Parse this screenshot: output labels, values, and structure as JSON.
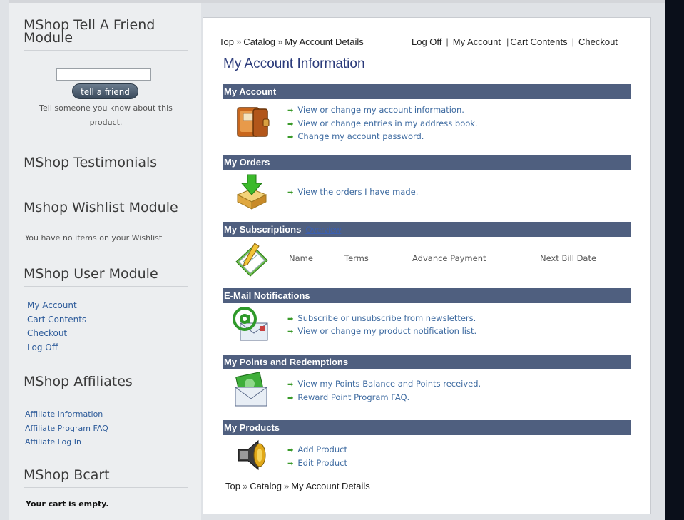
{
  "sidebar": {
    "tell_friend": {
      "title": "MShop Tell A Friend Module",
      "input_value": "",
      "button_label": "tell a friend",
      "description_line1": "Tell someone you know about this",
      "description_line2": "product."
    },
    "testimonials": {
      "title": "MShop Testimonials"
    },
    "wishlist": {
      "title": "Mshop Wishlist Module",
      "empty_text": "You have no items on your Wishlist"
    },
    "user_module": {
      "title": "MShop User Module",
      "links": [
        "My Account",
        "Cart Contents",
        "Checkout",
        "Log Off"
      ]
    },
    "affiliates": {
      "title": "MShop Affiliates",
      "links": [
        "Affiliate Information",
        "Affiliate Program FAQ",
        "Affiliate Log In"
      ]
    },
    "bcart": {
      "title": "MShop Bcart",
      "empty_text": "Your cart is empty."
    }
  },
  "breadcrumb": {
    "top": "Top",
    "sep": "»",
    "catalog": "Catalog",
    "current": "My Account Details"
  },
  "topnav": {
    "log_off": "Log Off",
    "my_account": "My Account",
    "cart_contents": "Cart Contents",
    "checkout": "Checkout",
    "sep": "|"
  },
  "page_title": "My Account Information",
  "sections": {
    "my_account": {
      "title": "My Account",
      "links": [
        "View or change my account information.",
        "View or change entries in my address book.",
        "Change my account password."
      ]
    },
    "my_orders": {
      "title": "My Orders",
      "links": [
        "View the orders I have made."
      ]
    },
    "my_subscriptions": {
      "title": "My Subscriptions",
      "overview_label": "Overview",
      "columns": [
        "Name",
        "Terms",
        "Advance Payment",
        "Next Bill Date"
      ]
    },
    "email_notifications": {
      "title": "E-Mail Notifications",
      "links": [
        "Subscribe or unsubscribe from newsletters.",
        "View or change my product notification list."
      ]
    },
    "points": {
      "title": "My Points and Redemptions",
      "links": [
        "View my Points Balance and Points received.",
        "Reward Point Program FAQ."
      ]
    },
    "my_products": {
      "title": "My Products",
      "links": [
        "Add Product",
        "Edit Product"
      ]
    }
  },
  "icons": {
    "account": "wallet-icon",
    "orders": "download-box-icon",
    "subscriptions": "notepad-pencil-icon",
    "email": "at-envelope-icon",
    "points": "money-envelope-icon",
    "products": "speaker-icon",
    "link_arrow": "green-arrow-icon"
  },
  "colors": {
    "section_bar": "#4f5f7f",
    "title": "#2a3a7a",
    "link": "#3d6aa0",
    "arrow": "#3a9a2a"
  }
}
